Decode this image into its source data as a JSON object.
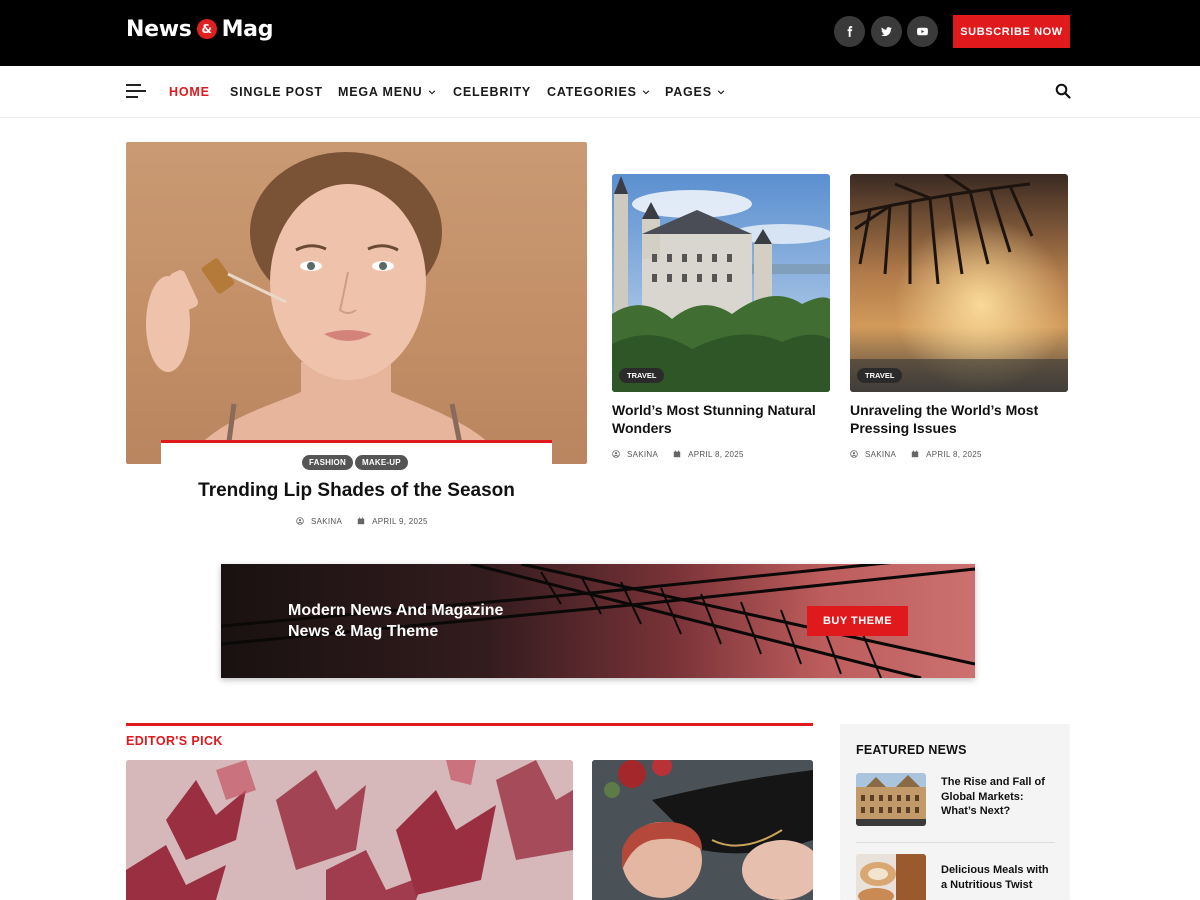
{
  "brand": {
    "left": "News",
    "amp": "&",
    "right": "Mag"
  },
  "header": {
    "social": [
      "facebook-icon",
      "twitter-icon",
      "youtube-icon"
    ],
    "subscribe_label": "SUBSCRIBE NOW"
  },
  "nav": {
    "items": [
      {
        "label": "HOME",
        "active": true,
        "has_dropdown": false
      },
      {
        "label": "SINGLE POST",
        "active": false,
        "has_dropdown": false
      },
      {
        "label": "MEGA MENU",
        "active": false,
        "has_dropdown": true
      },
      {
        "label": "CELEBRITY",
        "active": false,
        "has_dropdown": false
      },
      {
        "label": "CATEGORIES",
        "active": false,
        "has_dropdown": true
      },
      {
        "label": "PAGES",
        "active": false,
        "has_dropdown": true
      }
    ]
  },
  "hero": {
    "tags": [
      "FASHION",
      "MAKE-UP"
    ],
    "title": "Trending Lip Shades of the Season",
    "author": "SAKINA",
    "date": "APRIL 9, 2025"
  },
  "cards": [
    {
      "tag": "TRAVEL",
      "title_line1": "World’s Most Stunning Natural",
      "title_line2": "Wonders",
      "author": "SAKINA",
      "date": "APRIL 8, 2025"
    },
    {
      "tag": "TRAVEL",
      "title_line1": "Unraveling the World’s Most",
      "title_line2": "Pressing Issues",
      "author": "SAKINA",
      "date": "APRIL 8, 2025"
    }
  ],
  "banner": {
    "line1": "Modern News And Magazine",
    "line2": "News & Mag Theme",
    "button_label": "BUY THEME"
  },
  "editors_pick": {
    "title": "EDITOR'S PICK"
  },
  "featured": {
    "title": "FEATURED NEWS",
    "items": [
      {
        "line1": "The Rise and Fall of",
        "line2": "Global Markets:",
        "line3": "What’s Next?"
      },
      {
        "line1": "Delicious Meals with",
        "line2": "a Nutritious Twist",
        "line3": ""
      }
    ]
  },
  "colors": {
    "accent": "#e0191d",
    "topbar": "#000000"
  }
}
